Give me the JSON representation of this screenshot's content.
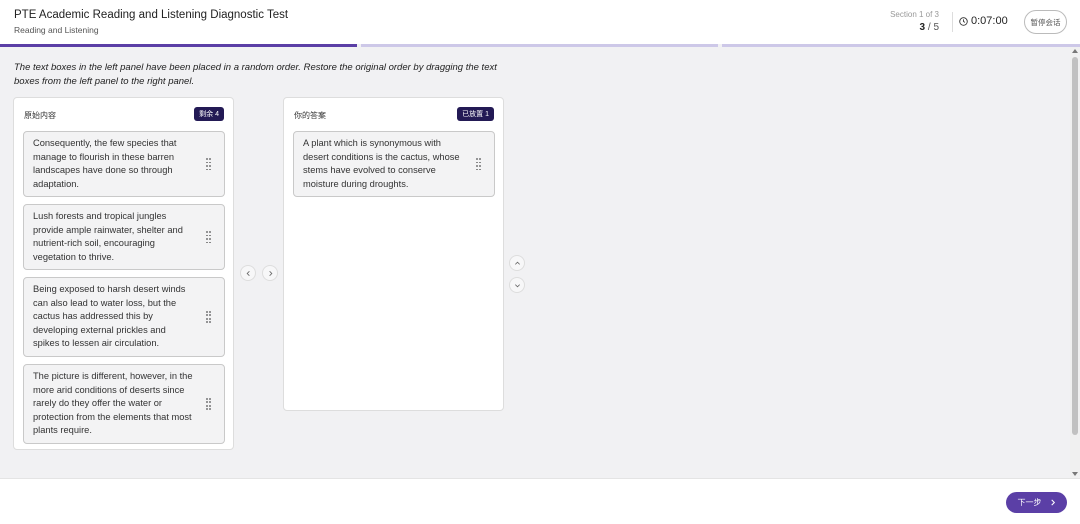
{
  "header": {
    "title": "PTE Academic Reading and Listening Diagnostic Test",
    "subtitle": "Reading and Listening",
    "section_label": "Section 1 of 3",
    "question_current": "3",
    "question_total": "5",
    "timer": "0:07:00",
    "pause_label": "暂停会话",
    "clock_icon": "clock-icon"
  },
  "progress": {
    "segments": [
      {
        "fill": 1.0
      },
      {
        "fill": 0.0
      },
      {
        "fill": 0.0
      },
      {
        "fill": 0.0
      }
    ],
    "colors": {
      "filled": "#5b3fa6",
      "empty": "#cdc8e8"
    }
  },
  "instruction": "The text boxes in the left panel have been placed in a random order. Restore the original order by dragging the text boxes from the left panel to the right panel.",
  "left_panel": {
    "title": "原始内容",
    "badge": "剩余 4",
    "cards": [
      {
        "text": "Consequently, the few species that manage to flourish in these barren landscapes have done so through adaptation."
      },
      {
        "text": "Lush forests and tropical jungles provide ample rainwater, shelter and nutrient-rich soil, encouraging vegetation to thrive."
      },
      {
        "text": "Being exposed to harsh desert winds can also lead to water loss, but the cactus has addressed this by developing external prickles and spikes to lessen air circulation."
      },
      {
        "text": "The picture is different, however, in the more arid conditions of deserts since rarely do they offer the water or protection from the elements that most plants require."
      }
    ]
  },
  "right_panel": {
    "title": "你的答案",
    "badge": "已放置 1",
    "cards": [
      {
        "text": "A plant which is synonymous with desert conditions is the cactus, whose stems have evolved to conserve moisture during droughts."
      }
    ]
  },
  "controls": {
    "move_left_icon": "chevron-left-icon",
    "move_right_icon": "chevron-right-icon",
    "move_up_icon": "chevron-up-icon",
    "move_down_icon": "chevron-down-icon"
  },
  "footer": {
    "next_label": "下一步"
  }
}
